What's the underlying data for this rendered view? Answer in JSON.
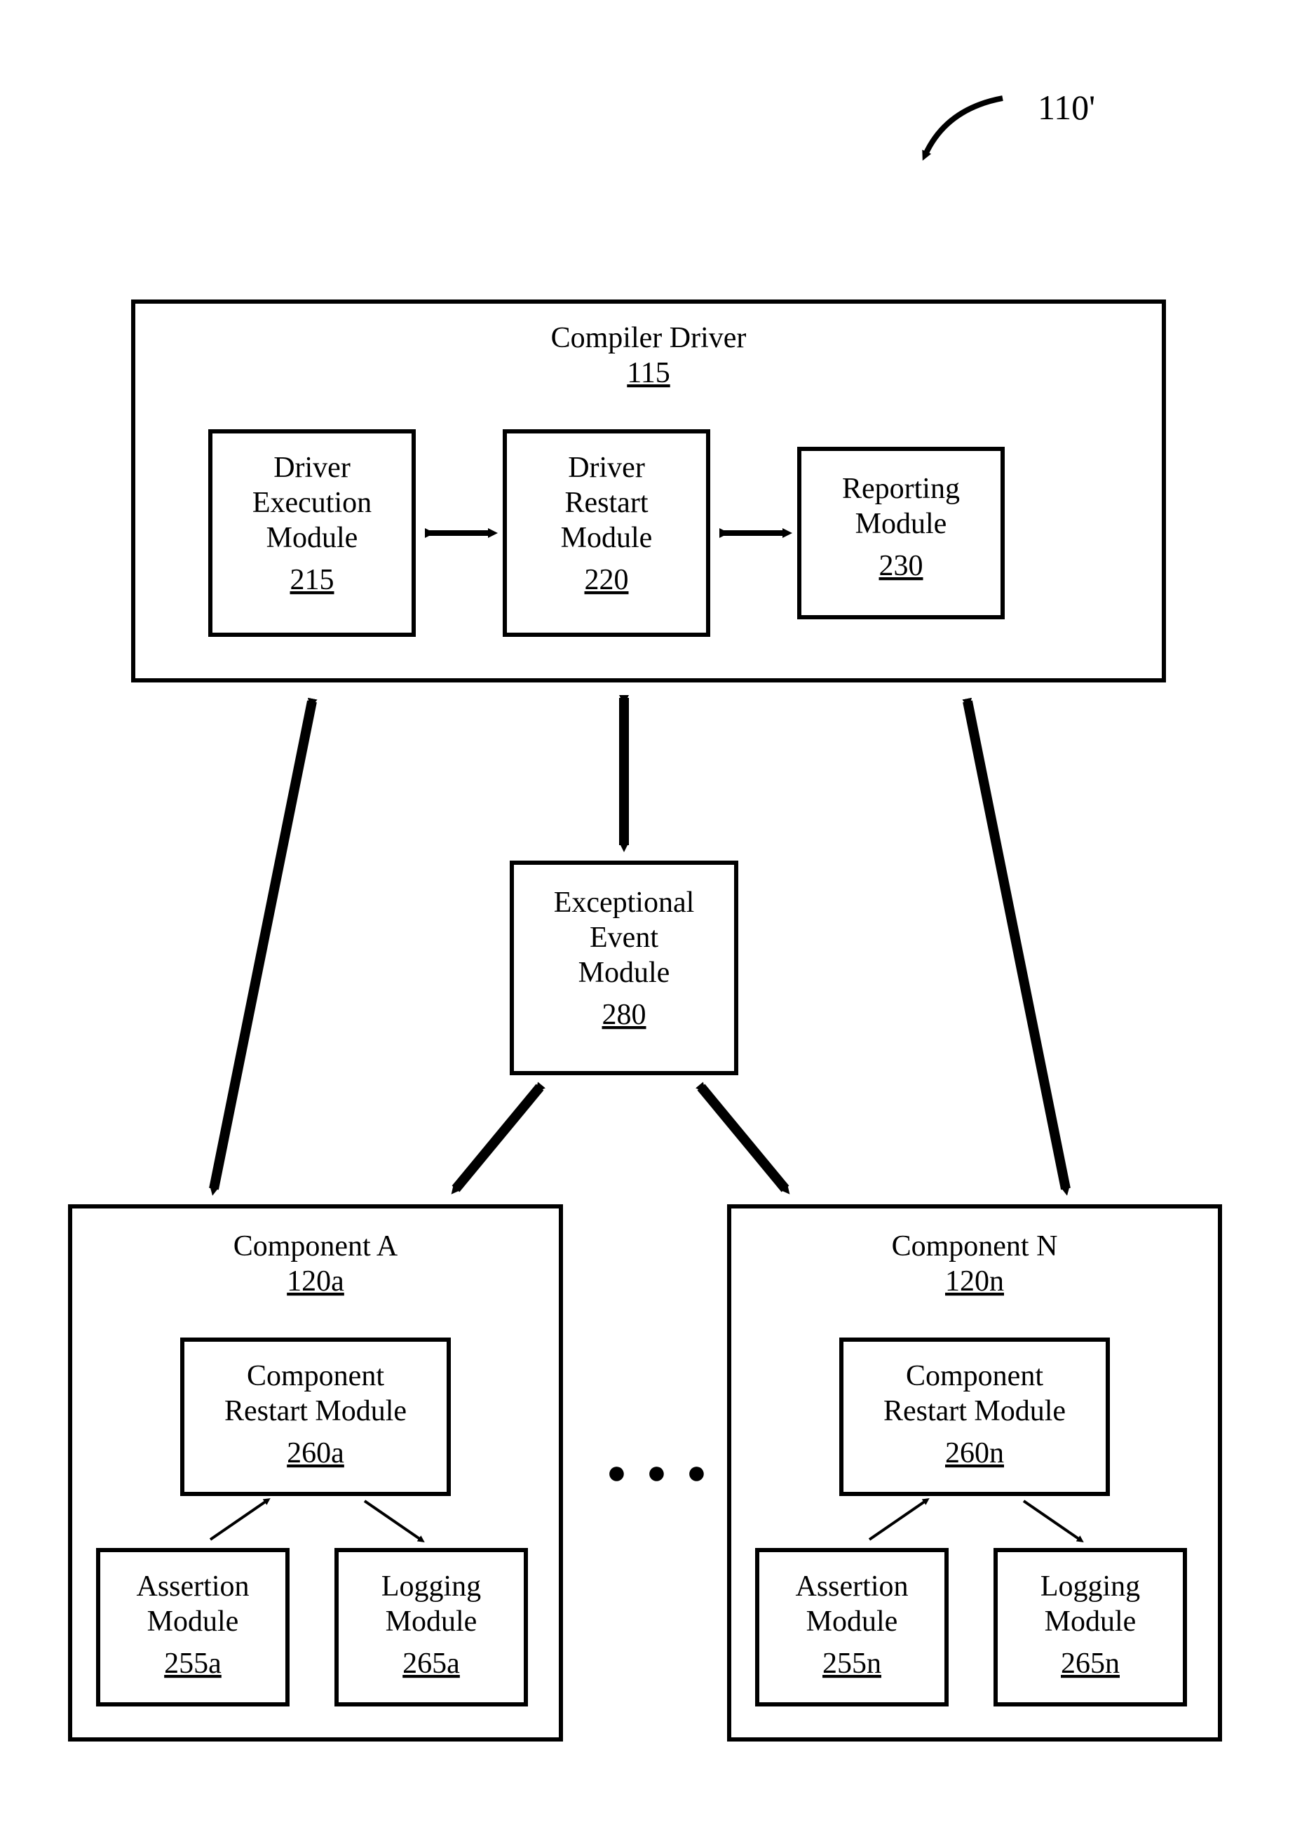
{
  "figureLabel": "110'",
  "compilerDriver": {
    "title": "Compiler Driver",
    "ref": "115"
  },
  "driverExecution": {
    "line1": "Driver",
    "line2": "Execution",
    "line3": "Module",
    "ref": "215"
  },
  "driverRestart": {
    "line1": "Driver",
    "line2": "Restart",
    "line3": "Module",
    "ref": "220"
  },
  "reporting": {
    "line1": "Reporting",
    "line2": "Module",
    "ref": "230"
  },
  "exceptional": {
    "line1": "Exceptional",
    "line2": "Event",
    "line3": "Module",
    "ref": "280"
  },
  "componentA": {
    "title": "Component A",
    "ref": "120a",
    "restart": {
      "line1": "Component",
      "line2": "Restart Module",
      "ref": "260a"
    },
    "assertion": {
      "line1": "Assertion",
      "line2": "Module",
      "ref": "255a"
    },
    "logging": {
      "line1": "Logging",
      "line2": "Module",
      "ref": "265a"
    }
  },
  "componentN": {
    "title": "Component N",
    "ref": "120n",
    "restart": {
      "line1": "Component",
      "line2": "Restart Module",
      "ref": "260n"
    },
    "assertion": {
      "line1": "Assertion",
      "line2": "Module",
      "ref": "255n"
    },
    "logging": {
      "line1": "Logging",
      "line2": "Module",
      "ref": "265n"
    }
  },
  "ellipsis": "● ● ●"
}
